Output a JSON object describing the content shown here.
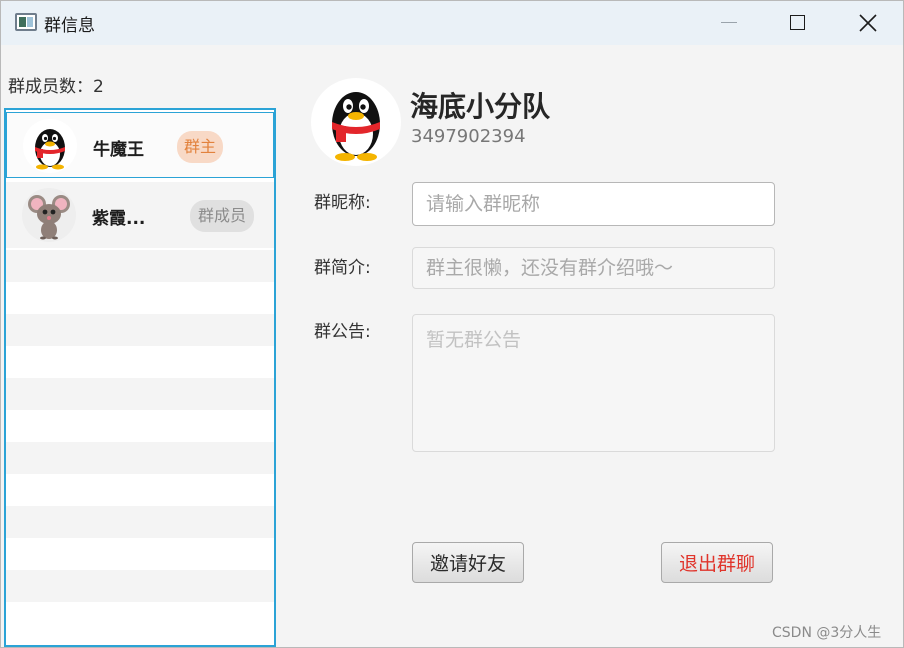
{
  "window": {
    "title": "群信息",
    "controls": [
      "minimize-icon",
      "maximize-icon",
      "close-icon"
    ]
  },
  "members": {
    "count_label": "群成员数：2",
    "items": [
      {
        "name": "牛魔王",
        "role": "群主",
        "avatar": "qq-penguin-avatar",
        "selected": true
      },
      {
        "name": "紫霞...",
        "role": "群成员",
        "avatar": "mouse-avatar",
        "selected": false
      }
    ]
  },
  "group": {
    "avatar": "qq-penguin-avatar",
    "name": "海底小分队",
    "id": "3497902394"
  },
  "form": {
    "nickname_label": "群昵称:",
    "nickname_placeholder": "请输入群昵称",
    "nickname_value": "",
    "intro_label": "群简介:",
    "intro_value": "群主很懒，还没有群介绍哦～",
    "notice_label": "群公告:",
    "notice_value": "暂无群公告"
  },
  "actions": {
    "invite_label": "邀请好友",
    "leave_label": "退出群聊"
  },
  "watermark": "CSDN @3分人生",
  "colors": {
    "list_border": "#2ba3d6",
    "owner_badge_bg": "#f8d9c6",
    "owner_badge_text": "#e2823d",
    "member_badge_bg": "#e0e0e0",
    "leave_text": "#e0342b"
  }
}
